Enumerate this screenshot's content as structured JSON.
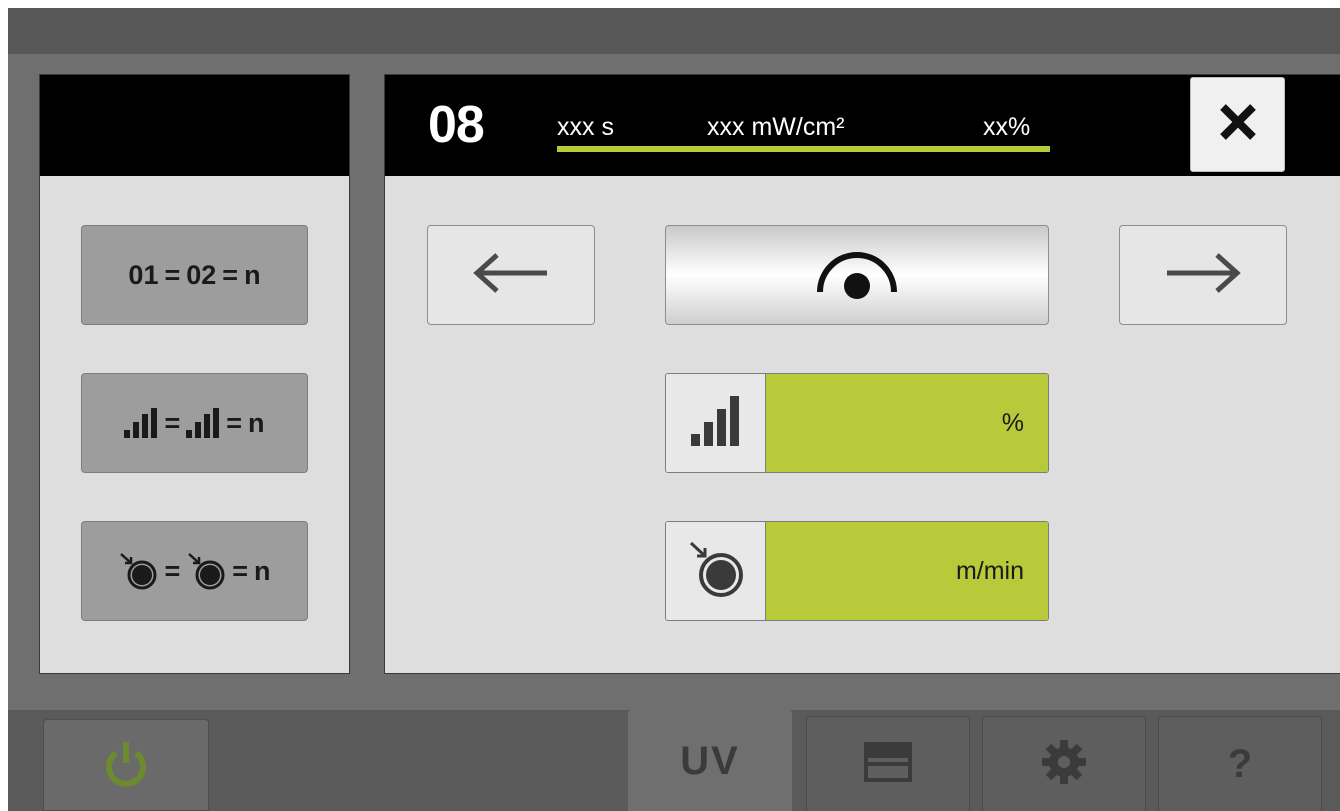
{
  "left_panel": {
    "buttons": [
      {
        "part1": "01",
        "eq1": "=",
        "part2": "02",
        "eq2": "=",
        "suffix": "n",
        "icon": "channel-numbers"
      },
      {
        "eq1": "=",
        "eq2": "=",
        "suffix": "n",
        "icon": "signal-bars-icon"
      },
      {
        "eq1": "=",
        "eq2": "=",
        "suffix": "n",
        "icon": "roller-speed-icon"
      }
    ]
  },
  "main_panel": {
    "channel": "08",
    "time": "xxx s",
    "irradiance": "xxx mW/cm²",
    "percent": "xx%",
    "close_icon": "close-icon",
    "prev_icon": "arrow-left-icon",
    "next_icon": "arrow-right-icon",
    "lamp_icon": "uv-lamp-icon",
    "intensity": {
      "icon": "signal-bars-icon",
      "unit": "%"
    },
    "speed": {
      "icon": "roller-speed-icon",
      "unit": "m/min"
    }
  },
  "tab_bar": {
    "power_icon": "power-icon",
    "tabs": [
      {
        "label": "UV",
        "active": true
      },
      {
        "icon": "list-icon"
      },
      {
        "icon": "gear-icon"
      },
      {
        "label": "?",
        "icon": "help-icon"
      }
    ]
  },
  "colors": {
    "accent": "#b8c93a",
    "header": "#000000",
    "panel": "#dedede",
    "frame": "#6f6f6f",
    "power": "#6c8a2e"
  }
}
